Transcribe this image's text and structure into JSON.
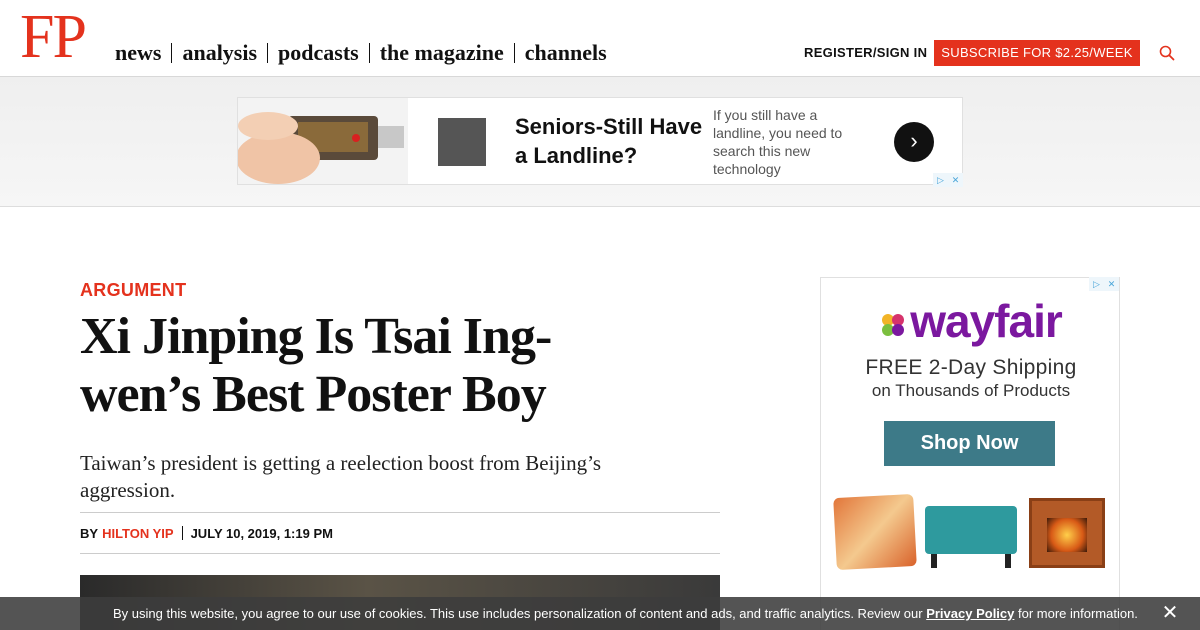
{
  "header": {
    "logo": "FP",
    "nav": [
      "news",
      "analysis",
      "podcasts",
      "the magazine",
      "channels"
    ],
    "register_label": "REGISTER/SIGN IN",
    "subscribe_label": "SUBSCRIBE FOR $2.25/WEEK"
  },
  "top_ad": {
    "headline": "Seniors-Still Have a Landline?",
    "description": "If you still have a landline, you need to search this new technology",
    "arrow": "›",
    "choices_i": "▷",
    "choices_x": "✕"
  },
  "article": {
    "kicker": "ARGUMENT",
    "headline": "Xi Jinping Is Tsai Ing-wen’s Best Poster Boy",
    "dek": "Taiwan’s president is getting a reelection boost from Beijing’s aggression.",
    "byline_prefix": "BY",
    "author": "HILTON YIP",
    "date": "JULY 10, 2019, 1:19 PM"
  },
  "side_ad": {
    "brand": "wayfair",
    "line1": "FREE 2-Day Shipping",
    "line2": "on Thousands of Products",
    "cta": "Shop Now",
    "choices_i": "▷",
    "choices_x": "✕"
  },
  "cookie_bar": {
    "text_before": "By using this website, you agree to our use of cookies. This use includes personalization of content and ads, and traffic analytics. Review our ",
    "link": "Privacy Policy",
    "text_after": " for more information.",
    "close": "✕"
  },
  "colors": {
    "brand_red": "#e4321d",
    "wayfair_purple": "#7b189f",
    "shop_button": "#3d7a88"
  }
}
